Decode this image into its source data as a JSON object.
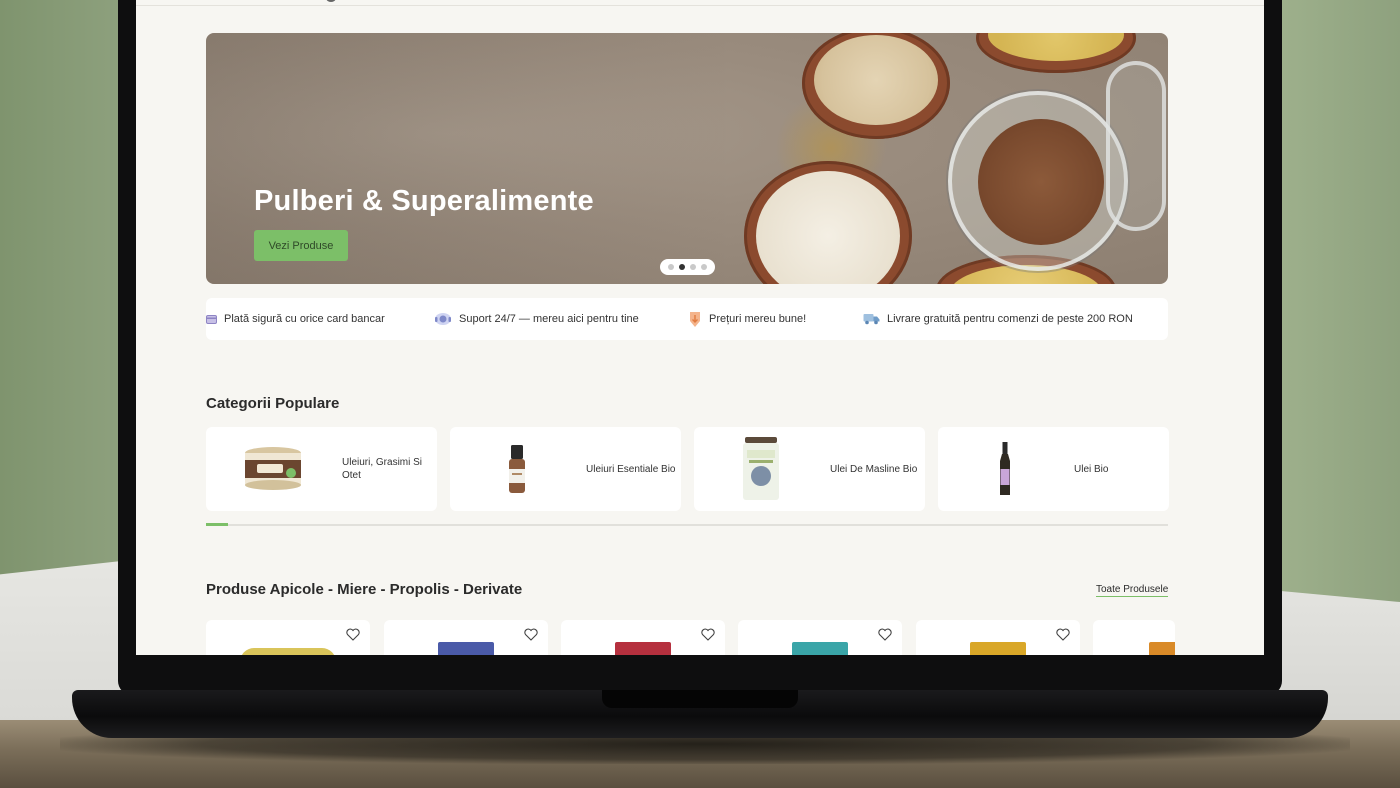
{
  "hero": {
    "title": "Pulberi & Superalimente",
    "button_label": "Vezi Produse",
    "slides_total": 4,
    "active_slide": 2
  },
  "features": [
    {
      "icon": "card-payment-icon",
      "text": "Plată sigură cu orice card bancar"
    },
    {
      "icon": "headset-support-icon",
      "text": "Suport 24/7 — mereu aici pentru tine"
    },
    {
      "icon": "price-tag-down-icon",
      "text": "Prețuri mereu bune!"
    },
    {
      "icon": "delivery-truck-icon",
      "text": "Livrare gratuită pentru comenzi de peste 200 RON"
    }
  ],
  "categories": {
    "title": "Categorii Populare",
    "items": [
      {
        "label": "Uleiuri, Grasimi Si Otet",
        "thumb": "butter-jar"
      },
      {
        "label": "Uleiuri Esentiale Bio",
        "thumb": "essential-oil-bottle"
      },
      {
        "label": "Ulei De Masline Bio",
        "thumb": "olive-oil-jar"
      },
      {
        "label": "Ulei Bio",
        "thumb": "oil-bottle"
      }
    ]
  },
  "products_section": {
    "title": "Produse Apicole - Miere - Propolis - Derivate",
    "all_link": "Toate Produsele"
  },
  "colors": {
    "accent": "#7cbf68",
    "page_bg": "#f7f6f2",
    "card_bg": "#ffffff"
  }
}
